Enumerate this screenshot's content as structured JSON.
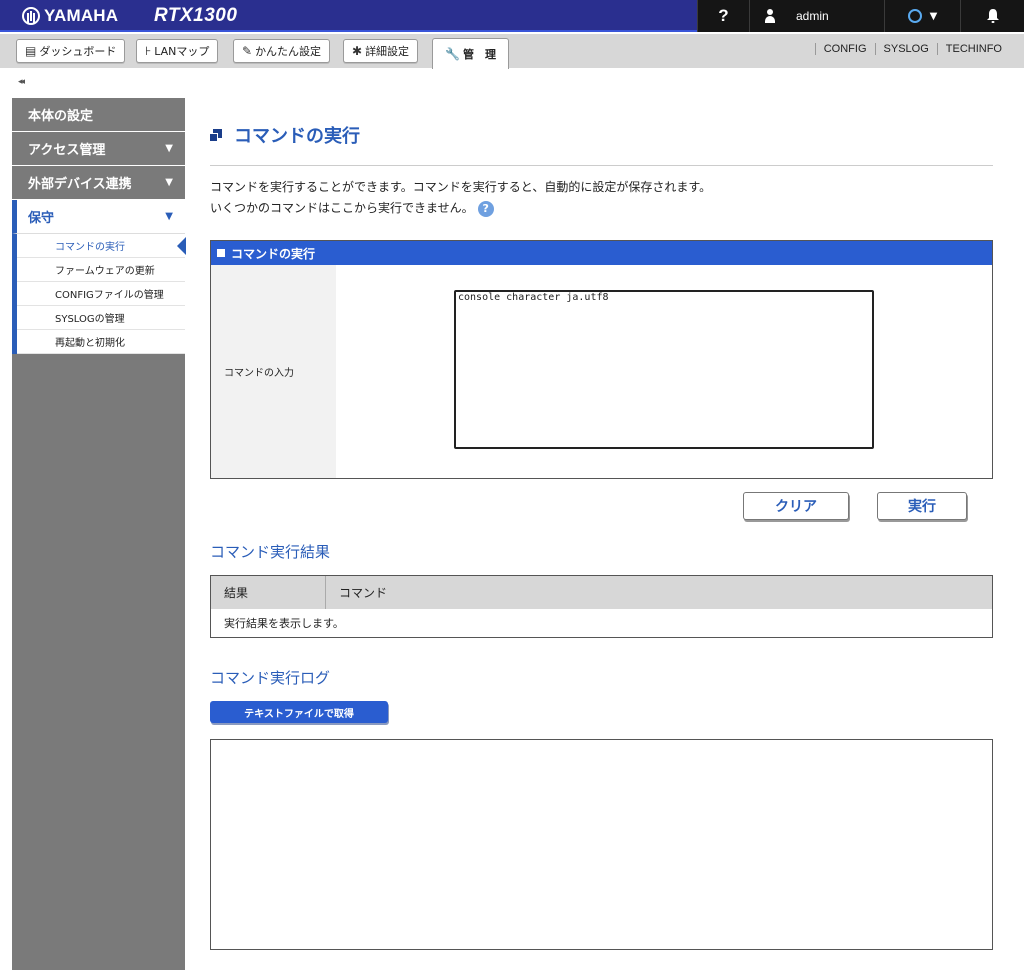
{
  "header": {
    "brand": "YAMAHA",
    "model": "RTX1300",
    "help": "?",
    "user": "admin",
    "status_icon": "ring-status-icon",
    "bell_icon": "bell-icon",
    "colors": {
      "header_bg": "#2a2f8f",
      "right_bg": "#151515",
      "status_ring": "#5aaaf0"
    }
  },
  "tabs": [
    {
      "label": "ダッシュボード",
      "icon": "dashboard-icon"
    },
    {
      "label": "LANマップ",
      "icon": "lan-map-icon"
    },
    {
      "label": "かんたん設定",
      "icon": "wizard-icon"
    },
    {
      "label": "詳細設定",
      "icon": "gear-icon"
    },
    {
      "label": "管　理",
      "icon": "wrench-icon",
      "active": true
    }
  ],
  "toplinks": [
    "CONFIG",
    "SYSLOG",
    "TECHINFO"
  ],
  "collapse": "◂◂",
  "sidebar": {
    "sections": [
      {
        "label": "本体の設定"
      },
      {
        "label": "アクセス管理",
        "arrow": "▼"
      },
      {
        "label": "外部デバイス連携",
        "arrow": "▼"
      },
      {
        "label": "保守",
        "arrow": "▼",
        "open": true
      }
    ],
    "sub_items": [
      "コマンドの実行",
      "ファームウェアの更新",
      "CONFIGファイルの管理",
      "SYSLOGの管理",
      "再起動と初期化"
    ]
  },
  "main": {
    "title": "コマンドの実行",
    "desc_line1": "コマンドを実行することができます。コマンドを実行すると、自動的に設定が保存されます。",
    "desc_line2": "いくつかのコマンドはここから実行できません。",
    "help_badge": "?",
    "box_title": "コマンドの実行",
    "input_label": "コマンドの入力",
    "command_value": "console character ja.utf8",
    "clear_label": "クリア",
    "exec_label": "実行",
    "result_title": "コマンド実行結果",
    "result_col_result": "結果",
    "result_col_command": "コマンド",
    "result_placeholder": "実行結果を表示します。",
    "log_title": "コマンド実行ログ",
    "download_label": "テキストファイルで取得",
    "accent_color": "#2a5db8"
  }
}
